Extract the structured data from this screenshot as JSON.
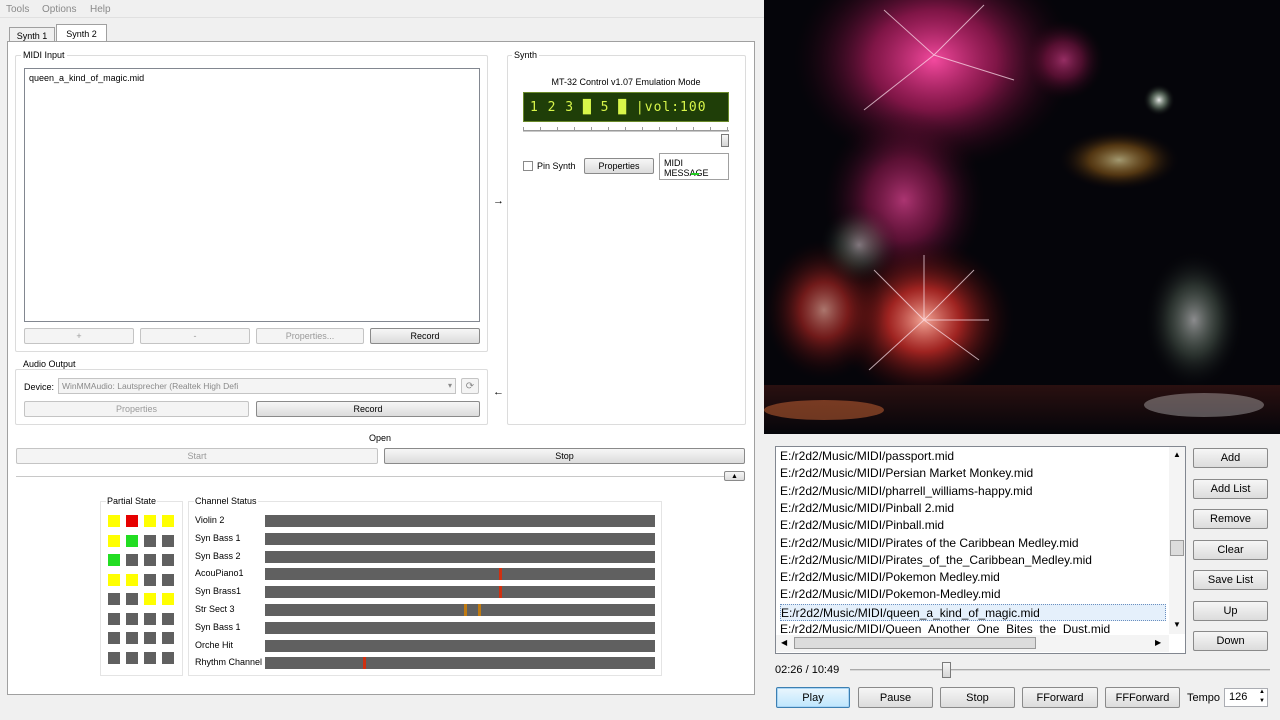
{
  "menu": [
    "Tools",
    "Options",
    "Help"
  ],
  "tabs": [
    {
      "label": "Synth 1"
    },
    {
      "label": "Synth 2"
    }
  ],
  "midi_input": {
    "title": "MIDI Input",
    "items": [
      "queen_a_kind_of_magic.mid"
    ],
    "buttons": {
      "add": "+",
      "remove": "-",
      "properties": "Properties...",
      "record": "Record"
    }
  },
  "synth": {
    "title": "Synth",
    "mode_label": "MT-32 Control v1.07 Emulation Mode",
    "lcd_text": "1 2 3 █ 5 █ |vol:100",
    "pin_label": "Pin Synth",
    "properties_label": "Properties",
    "midi_message_label": "MIDI MESSAGE",
    "volume_level": 1.0
  },
  "arrows": {
    "right": "→",
    "left": "←"
  },
  "audio_output": {
    "title": "Audio Output",
    "device_label": "Device:",
    "device_value": "WinMMAudio: Lautsprecher (Realtek High Defi",
    "properties_label": "Properties",
    "record_label": "Record"
  },
  "transport": {
    "open_label": "Open",
    "start_label": "Start",
    "stop_label": "Stop",
    "collapse_icon": "triangle-up-icon"
  },
  "partial_state": {
    "title": "Partial State",
    "colors": {
      "yellow": "#ffff00",
      "red": "#e60000",
      "green": "#22dd22",
      "gray": "#606060"
    },
    "grid": [
      [
        "yellow",
        "red",
        "yellow",
        "yellow"
      ],
      [
        "yellow",
        "green",
        "gray",
        "gray"
      ],
      [
        "green",
        "gray",
        "gray",
        "gray"
      ],
      [
        "yellow",
        "yellow",
        "gray",
        "gray"
      ],
      [
        "gray",
        "gray",
        "yellow",
        "yellow"
      ],
      [
        "gray",
        "gray",
        "gray",
        "gray"
      ],
      [
        "gray",
        "gray",
        "gray",
        "gray"
      ],
      [
        "gray",
        "gray",
        "gray",
        "gray"
      ]
    ]
  },
  "channel_status": {
    "title": "Channel Status",
    "channels": [
      {
        "name": "Violin 2",
        "marks": []
      },
      {
        "name": "Syn Bass 1",
        "marks": []
      },
      {
        "name": "Syn Bass 2",
        "marks": []
      },
      {
        "name": "AcouPiano1",
        "marks": [
          {
            "pos": 0.6,
            "color": "#d03010"
          }
        ]
      },
      {
        "name": "Syn Brass1",
        "marks": [
          {
            "pos": 0.6,
            "color": "#d03010"
          }
        ]
      },
      {
        "name": "Str Sect 3",
        "marks": [
          {
            "pos": 0.51,
            "color": "#c07a10"
          },
          {
            "pos": 0.545,
            "color": "#c07a10"
          }
        ]
      },
      {
        "name": "Syn Bass 1",
        "marks": []
      },
      {
        "name": "Orche Hit",
        "marks": []
      },
      {
        "name": "Rhythm Channel",
        "marks": [
          {
            "pos": 0.25,
            "color": "#d03010"
          }
        ]
      }
    ]
  },
  "playlist": {
    "items": [
      "E:/r2d2/Music/MIDI/passport.mid",
      "E:/r2d2/Music/MIDI/Persian Market Monkey.mid",
      "E:/r2d2/Music/MIDI/pharrell_williams-happy.mid",
      "E:/r2d2/Music/MIDI/Pinball 2.mid",
      "E:/r2d2/Music/MIDI/Pinball.mid",
      "E:/r2d2/Music/MIDI/Pirates of the Caribbean Medley.mid",
      "E:/r2d2/Music/MIDI/Pirates_of_the_Caribbean_Medley.mid",
      "E:/r2d2/Music/MIDI/Pokemon Medley.mid",
      "E:/r2d2/Music/MIDI/Pokemon-Medley.mid",
      "E:/r2d2/Music/MIDI/queen_a_kind_of_magic.mid",
      "E:/r2d2/Music/MIDI/Queen_Another_One_Bites_the_Dust.mid"
    ],
    "selected_index": 9,
    "buttons": {
      "add": "Add",
      "add_list": "Add List",
      "remove": "Remove",
      "clear": "Clear",
      "save_list": "Save List",
      "up": "Up",
      "down": "Down"
    }
  },
  "player": {
    "time": "02:26 / 10:49",
    "progress": 0.225,
    "buttons": {
      "play": "Play",
      "pause": "Pause",
      "stop": "Stop",
      "fforward": "FForward",
      "ffforward": "FFForward"
    },
    "tempo_label": "Tempo",
    "tempo_value": "126"
  }
}
